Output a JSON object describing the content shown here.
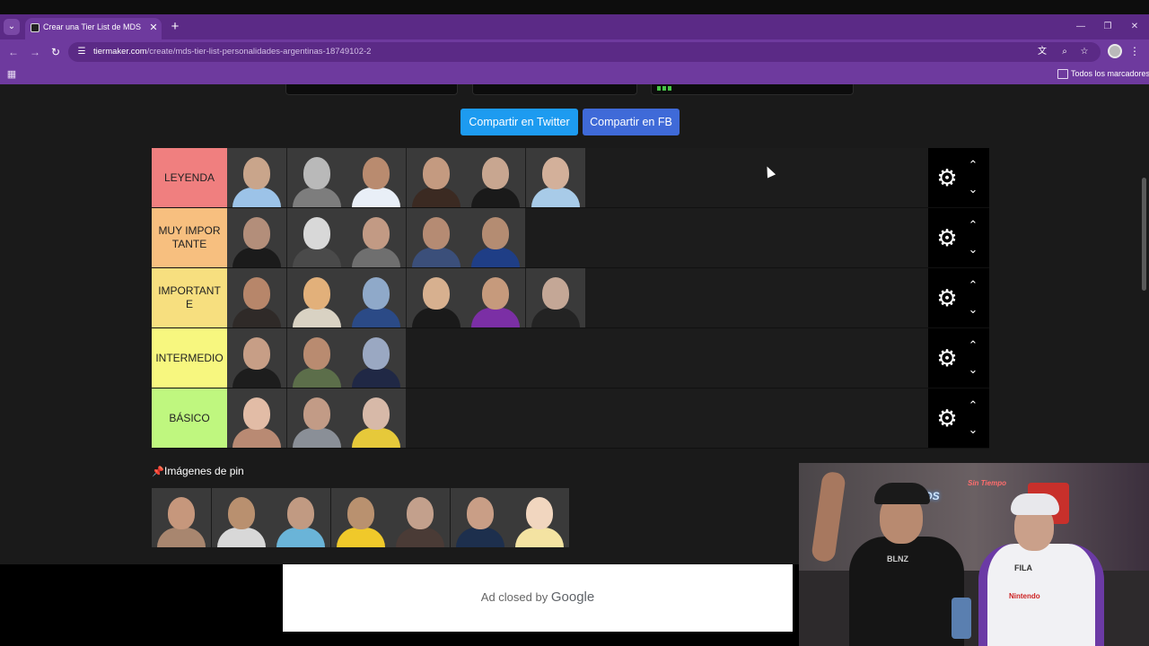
{
  "browser": {
    "tab_title": "Crear una Tier List de MDS Per",
    "tab_close": "✕",
    "new_tab": "+",
    "url_host": "tiermaker.com",
    "url_path": "/create/mds-tier-list-personalidades-argentinas-18749102-2",
    "bookmark_folder": "Todos los marcadores",
    "icons": [
      "chevron-down-icon",
      "back-icon",
      "forward-icon",
      "reload-icon",
      "site-info-icon",
      "translate-icon",
      "zoom-icon",
      "star-icon",
      "profile-icon",
      "menu-icon",
      "apps-icon",
      "folder-icon",
      "minimize-icon",
      "restore-icon",
      "close-icon"
    ]
  },
  "share": {
    "twitter_label": "Compartir en Twitter",
    "fb_label": "Compartir en FB",
    "twitter_color": "#1d9bf0",
    "fb_color": "#3f6ad8"
  },
  "tiers": [
    {
      "label": "LEYENDA",
      "color": "#f07f7f",
      "items": [
        {
          "face": "#c9a58b",
          "body": "#9cc3e8"
        },
        {
          "face": "#b9b9b9",
          "body": "#7d7d7d"
        },
        {
          "face": "#b98b6f",
          "body": "#e9eff7"
        },
        {
          "face": "#c49a80",
          "body": "#3b2a22"
        },
        {
          "face": "#c8a690",
          "body": "#1a1a1a"
        },
        {
          "face": "#d3b09a",
          "body": "#a8cbe8"
        }
      ]
    },
    {
      "label": "MUY IMPORTANTE",
      "color": "#f7bf7f",
      "items": [
        {
          "face": "#b38e7a",
          "body": "#1b1b1b"
        },
        {
          "face": "#d8d8d8",
          "body": "#4a4a4a"
        },
        {
          "face": "#c29a84",
          "body": "#6f6f6f"
        },
        {
          "face": "#b58b73",
          "body": "#3b4f7a"
        },
        {
          "face": "#b48c72",
          "body": "#1f3e86"
        }
      ]
    },
    {
      "label": "IMPORTANTE",
      "color": "#f7df7f",
      "items": [
        {
          "face": "#b7866a",
          "body": "#2f2a28"
        },
        {
          "face": "#e2b07a",
          "body": "#d9d2c3"
        },
        {
          "face": "#8fa9c9",
          "body": "#2b4a86"
        },
        {
          "face": "#d7b08f",
          "body": "#1a1a1a"
        },
        {
          "face": "#c69a7c",
          "body": "#7b2fa5"
        },
        {
          "face": "#c4a796",
          "body": "#232323"
        }
      ]
    },
    {
      "label": "INTERMEDIO",
      "color": "#f7f77f",
      "items": [
        {
          "face": "#c79e86",
          "body": "#1d1d1d"
        },
        {
          "face": "#b98b70",
          "body": "#5c6e4a"
        },
        {
          "face": "#9aa8c2",
          "body": "#202845"
        }
      ]
    },
    {
      "label": "BÁSICO",
      "color": "#bff77f",
      "items": [
        {
          "face": "#e2bca6",
          "body": "#b98a73"
        },
        {
          "face": "#c29b86",
          "body": "#8a8f97"
        },
        {
          "face": "#d7b9a8",
          "body": "#e6c93a"
        }
      ]
    }
  ],
  "controls": {
    "gear": "⚙",
    "up": "⌃",
    "down": "⌄"
  },
  "pins": {
    "title": "Imágenes de pin",
    "items": [
      {
        "face": "#c6977c",
        "body": "#a8866f"
      },
      {
        "face": "#b9906f",
        "body": "#d8d8d8"
      },
      {
        "face": "#c19a82",
        "body": "#6ab4d8"
      },
      {
        "face": "#b9916f",
        "body": "#f0c92a"
      },
      {
        "face": "#c3a08c",
        "body": "#4a3b36"
      },
      {
        "face": "#c99e86",
        "body": "#1d2f4d"
      },
      {
        "face": "#f1d6bf",
        "body": "#f4e3a2"
      }
    ]
  },
  "ad": {
    "text": "Ad closed by",
    "brand": "Google"
  },
  "webcam": {
    "sign_left": "MDS",
    "sign_small": "Sin Tiempo",
    "shirt_left": "BLNZ",
    "shirt_right": "FILA",
    "shirt_right2": "Nintendo"
  }
}
